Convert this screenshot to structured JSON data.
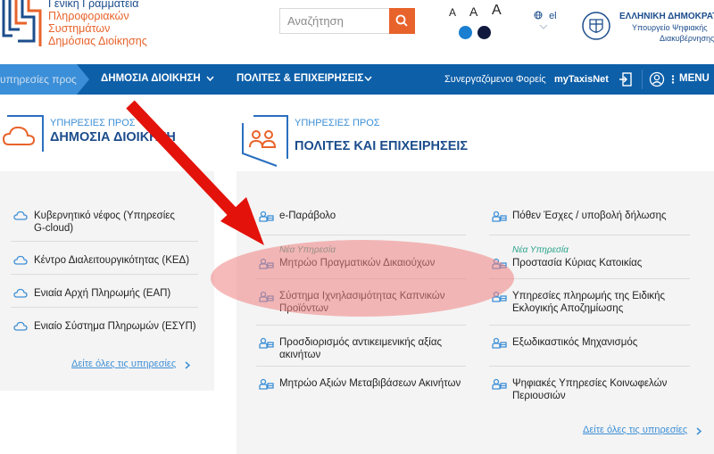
{
  "logo": {
    "lines": [
      "Γενική Γραμματεία",
      "Πληροφοριακών",
      "Συστημάτων",
      "Δημόσιας Διοίκησης"
    ]
  },
  "search": {
    "placeholder": "Αναζήτηση"
  },
  "font_size": {
    "small": "A",
    "medium": "A",
    "large": "A"
  },
  "contrast": {
    "color_a": "#1a7fd1",
    "color_b": "#10193d"
  },
  "language": {
    "label": "el"
  },
  "government": {
    "title": "ΕΛΛΗΝΙΚΗ ΔΗΜΟΚΡΑΤΙΑ",
    "ministry_line1": "Υπουργείο Ψηφιακής",
    "ministry_line2": "Διακυβέρνησης"
  },
  "nav": {
    "partial": "υπηρεσίες προς",
    "public_admin": "ΔΗΜΟΣΙΑ ΔΙΟΙΚΗΣΗ",
    "citizens": "ΠΟΛΙΤΕΣ & ΕΠΙΧΕΙΡΗΣΕΙΣ",
    "partners": "Συνεργαζόμενοι Φορείς",
    "mytaxisnet": "myTaxisNet",
    "menu": "MENU"
  },
  "left_section": {
    "sup": "ΥΠΗΡΕΣΙΕΣ ΠΡΟΣ",
    "title": "ΔΗΜΟΣΙΑ ΔΙΟΙΚΗΣΗ",
    "items": [
      {
        "line1": "Κυβερνητικό νέφος (Υπηρεσίες",
        "line2": "G-cloud)"
      },
      {
        "line1": "Κέντρο Διαλειτουργικότητας (ΚΕΔ)",
        "line2": ""
      },
      {
        "line1": "Ενιαία Αρχή Πληρωμής (ΕΑΠ)",
        "line2": ""
      },
      {
        "line1": "Ενιαίο Σύστημα Πληρωμών (ΕΣΥΠ)",
        "line2": ""
      }
    ],
    "see_all": "Δείτε όλες τις υπηρεσίες"
  },
  "right_section": {
    "sup": "ΥΠΗΡΕΣΙΕΣ ΠΡΟΣ",
    "title": "ΠΟΛΙΤΕΣ ΚΑΙ ΕΠΙΧΕΙΡΗΣΕΙΣ",
    "new_label": "Νέα Υπηρεσία",
    "col1": [
      {
        "line1": "e-Παράβολο",
        "line2": ""
      },
      {
        "line1": "Μητρώο Πραγματικών Δικαιούχων",
        "line2": ""
      },
      {
        "line1": "Σύστημα Ιχνηλασιμότητας Καπνικών",
        "line2": "Προϊόντων"
      },
      {
        "line1": "Προσδιορισμός αντικειμενικής αξίας",
        "line2": "ακινήτων"
      },
      {
        "line1": "Μητρώο Αξιών Μεταβιβάσεων Ακινήτων",
        "line2": ""
      }
    ],
    "col2": [
      {
        "line1": "Πόθεν Έσχες / υποβολή δήλωσης",
        "line2": ""
      },
      {
        "line1": "Προστασία Κύριας Κατοικίας",
        "line2": ""
      },
      {
        "line1": "Υπηρεσίες πληρωμής της Ειδικής",
        "line2": "Εκλογικής Αποζημίωσης"
      },
      {
        "line1": "Εξωδικαστικός Μηχανισμός",
        "line2": ""
      },
      {
        "line1": "Ψηφιακές Υπηρεσίες Κοινωφελών",
        "line2": "Περιουσιών"
      }
    ],
    "see_all": "Δείτε όλες τις υπηρεσίες"
  },
  "colors": {
    "primary": "#0d5fa8",
    "accent": "#e8632b",
    "link": "#3d8fd6",
    "new": "#2aa38a",
    "annotation": "#e3120b"
  }
}
